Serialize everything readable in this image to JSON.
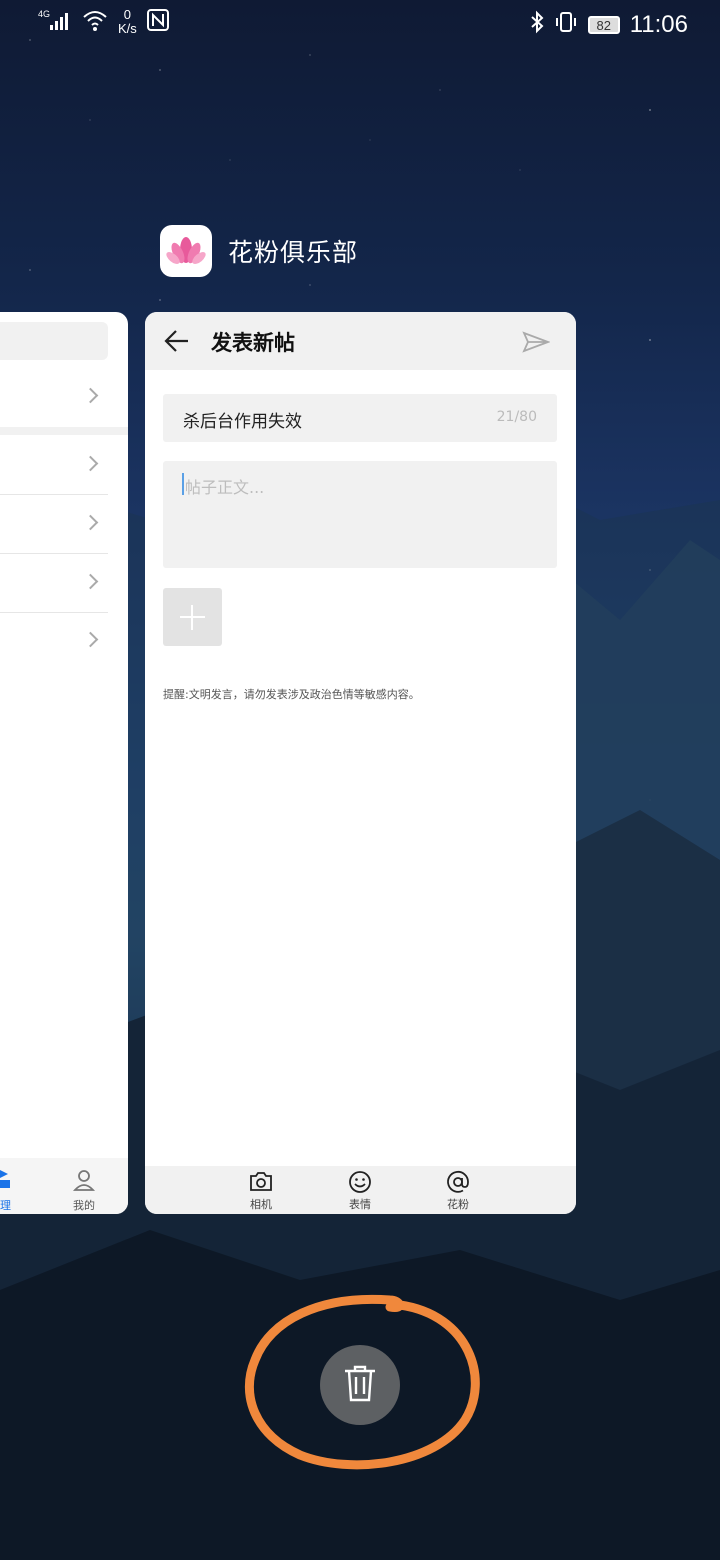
{
  "status_bar": {
    "network_type": "4G",
    "net_speed_value": "0",
    "net_speed_unit": "K/s",
    "battery": "82",
    "time": "11:06"
  },
  "recents": {
    "app_name": "花粉俱乐部"
  },
  "left_card": {
    "tabs": [
      {
        "label": "理",
        "icon": "manage-icon"
      },
      {
        "label": "我的",
        "icon": "person-icon"
      }
    ]
  },
  "main_card": {
    "title": "发表新帖",
    "post_title_value": "杀后台作用失效",
    "title_char_count": "21/80",
    "body_placeholder": "帖子正文...",
    "reminder": "提醒:文明发言，请勿发表涉及政治色情等敏感内容。",
    "tools": [
      {
        "label": "相机",
        "icon": "camera-icon"
      },
      {
        "label": "表情",
        "icon": "emoji-icon"
      },
      {
        "label": "花粉",
        "icon": "at-icon"
      }
    ]
  },
  "colors": {
    "annotation_circle": "#f0883c",
    "accent_blue": "#1a73e8"
  }
}
